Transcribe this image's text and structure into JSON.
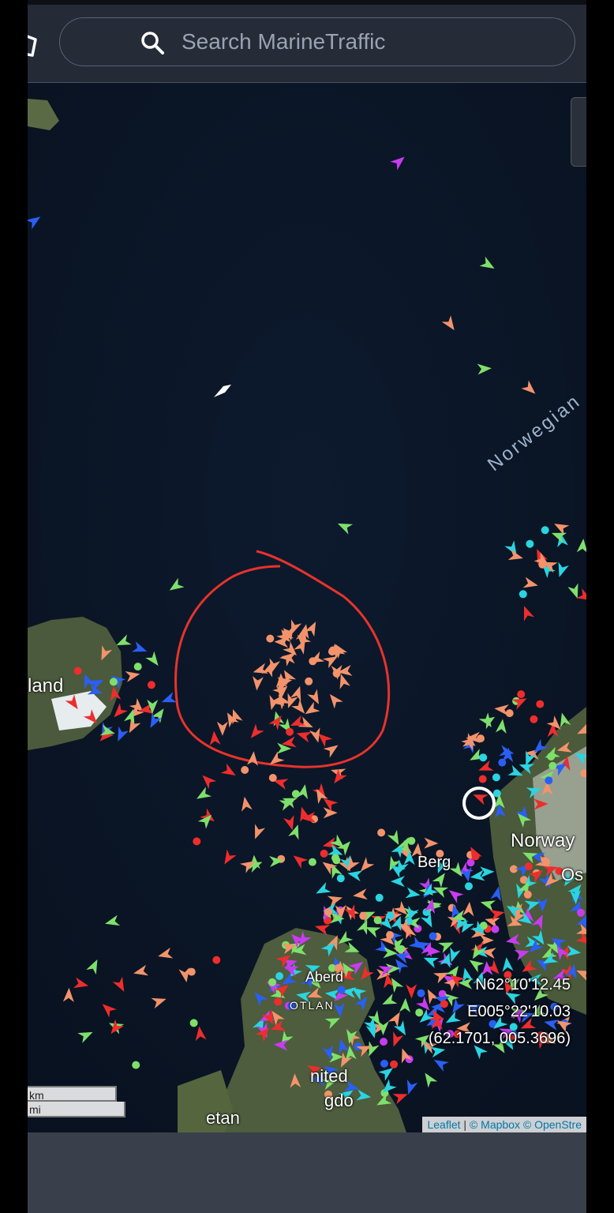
{
  "search": {
    "placeholder": "Search MarineTraffic"
  },
  "map": {
    "labels": {
      "iceland": "land",
      "norway": "Norway",
      "oslo": "Os",
      "bergen": "Berg",
      "aberdeen": "Aberd",
      "scotland": "OTLAN",
      "united": "nited",
      "kingdom": "gdo",
      "ireland": "etan"
    },
    "sea_label": "Norwegian",
    "coords": {
      "lat": "N62°10'12.45",
      "lon": "E005°22'10.03",
      "decimal": "(62.1701, 005.3696)"
    },
    "scale": {
      "km": "km",
      "mi": "mi"
    },
    "attribution": {
      "leaflet": "Leaflet",
      "sep": "|",
      "mapbox": "© Mapbox",
      "osm": "© OpenStre"
    }
  },
  "colors": {
    "tanker": "#f3936b",
    "cargo": "#7ee06b",
    "passenger": "#2ad4e0",
    "fishing": "#ee2d2d",
    "tug": "#2a5ff5",
    "pleasure": "#c83cf0",
    "annotation": "#e8332b",
    "sea": "#0b1424"
  }
}
